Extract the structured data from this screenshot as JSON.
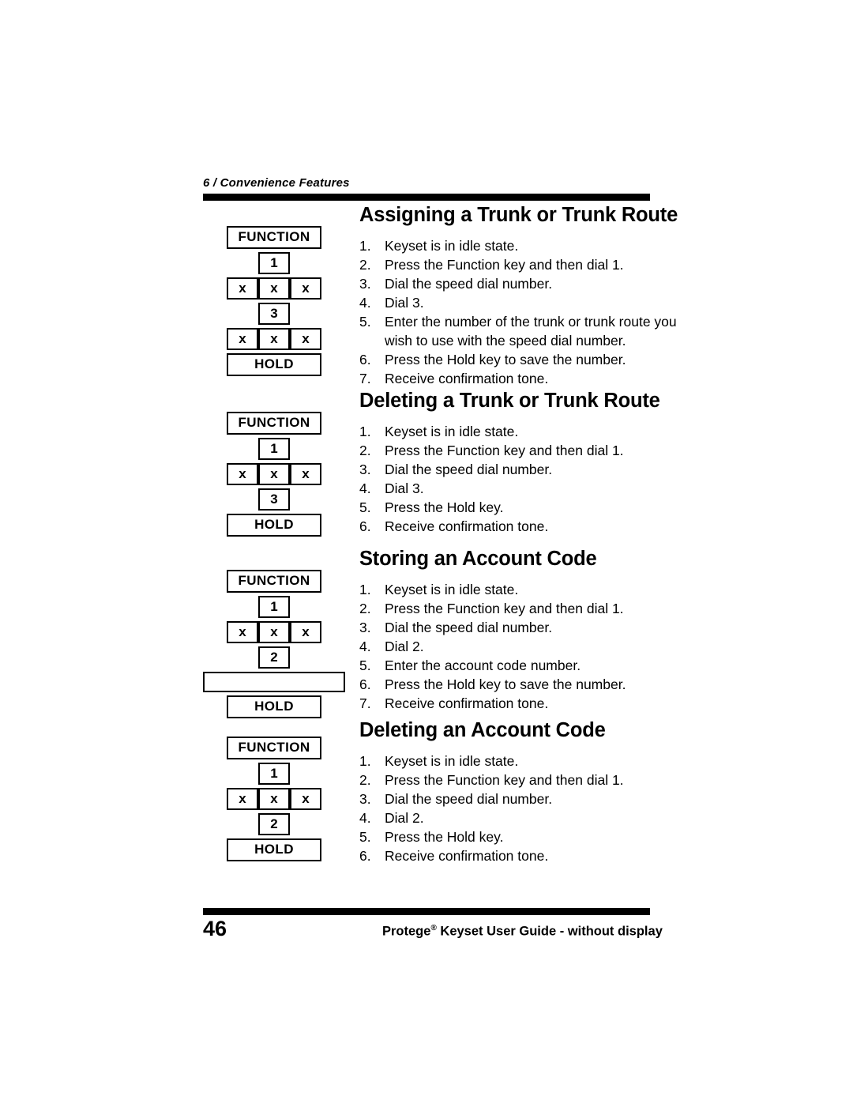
{
  "header": {
    "chapter": "6 / Convenience Features"
  },
  "sections": [
    {
      "title": "Assigning a Trunk or Trunk Route",
      "keys": [
        "FUNCTION",
        "1",
        "x x x",
        "3",
        "x x x",
        "HOLD"
      ],
      "steps": [
        "Keyset is in idle state.",
        "Press the Function key and then dial 1.",
        "Dial the speed dial number.",
        "Dial 3.",
        "Enter the number of the trunk or trunk route you wish to use with the speed dial number.",
        "Press the Hold key to save the number.",
        "Receive confirmation tone."
      ]
    },
    {
      "title": "Deleting a Trunk or Trunk Route",
      "keys": [
        "FUNCTION",
        "1",
        "x x x",
        "3",
        "HOLD"
      ],
      "steps": [
        "Keyset is in idle state.",
        "Press the Function key and then dial 1.",
        "Dial the speed dial number.",
        "Dial 3.",
        "Press the Hold key.",
        "Receive confirmation tone."
      ]
    },
    {
      "title": "Storing an Account Code",
      "keys": [
        "FUNCTION",
        "1",
        "x x x",
        "2",
        "blank",
        "HOLD"
      ],
      "steps": [
        "Keyset is in idle state.",
        "Press the Function key and then dial 1.",
        "Dial the speed dial number.",
        "Dial 2.",
        "Enter the account code number.",
        "Press the Hold key to save the number.",
        "Receive confirmation tone."
      ]
    },
    {
      "title": "Deleting an Account Code",
      "keys": [
        "FUNCTION",
        "1",
        "x x x",
        "2",
        "HOLD"
      ],
      "steps": [
        "Keyset is in idle state.",
        "Press the Function key and then dial 1.",
        "Dial the speed dial number.",
        "Dial 2.",
        "Press the Hold key.",
        "Receive confirmation tone."
      ]
    }
  ],
  "keys": {
    "function": "FUNCTION",
    "hold": "HOLD",
    "one": "1",
    "two": "2",
    "three": "3",
    "x": "x"
  },
  "footer": {
    "page_number": "46",
    "product": "Protege",
    "registered": "®",
    "doc_title": " Keyset User Guide - without display"
  }
}
